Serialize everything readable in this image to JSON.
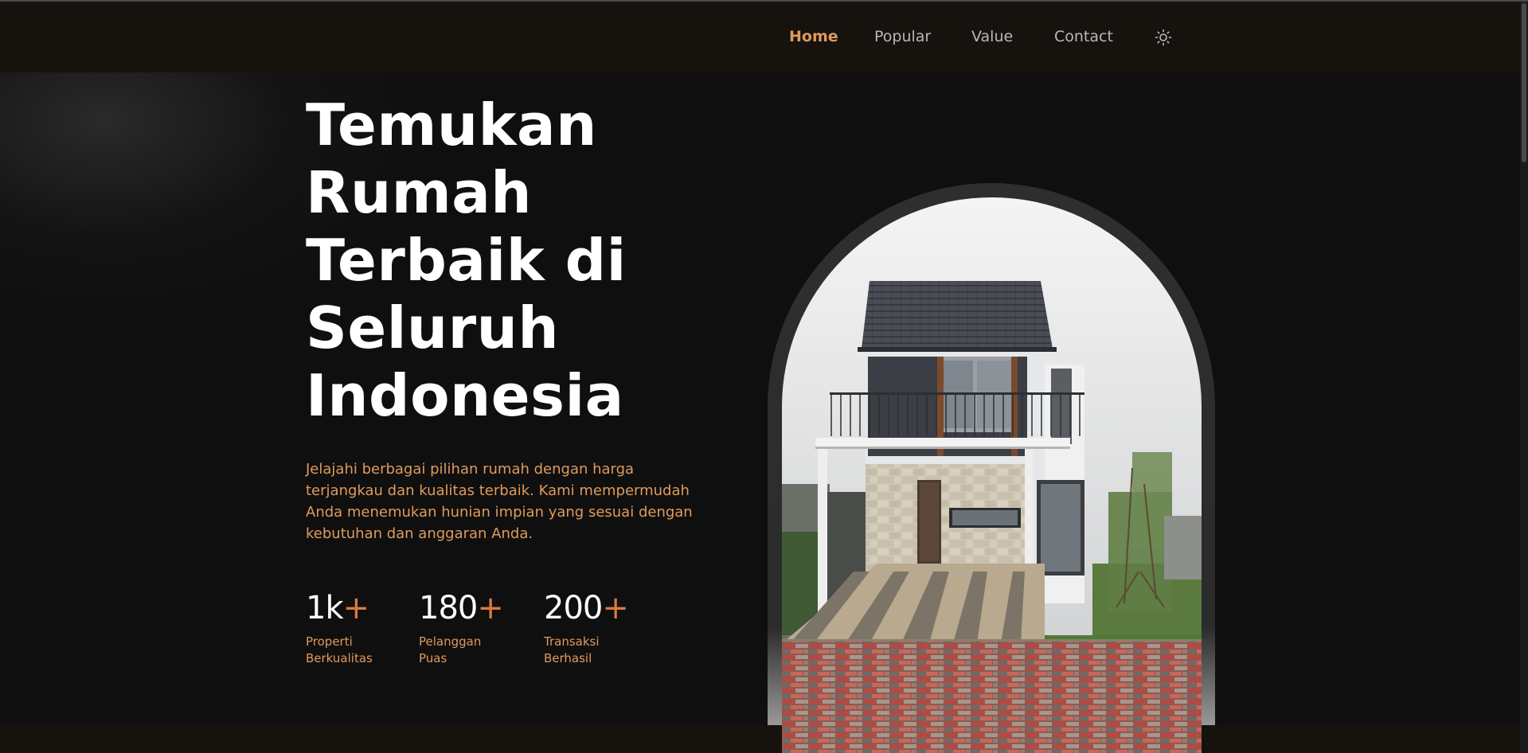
{
  "nav": {
    "items": [
      {
        "label": "Home",
        "active": true
      },
      {
        "label": "Popular",
        "active": false
      },
      {
        "label": "Value",
        "active": false
      },
      {
        "label": "Contact",
        "active": false
      }
    ],
    "theme_toggle_icon": "sun-icon"
  },
  "hero": {
    "title_lines": [
      "Temukan",
      "Rumah",
      "Terbaik di",
      "Seluruh",
      "Indonesia"
    ],
    "description": "Jelajahi berbagai pilihan rumah dengan harga terjangkau dan kualitas terbaik. Kami mempermudah Anda menemukan hunian impian yang sesuai dengan kebutuhan dan anggaran Anda.",
    "stats": [
      {
        "number": "1k",
        "plus": "+",
        "label": "Properti Berkualitas"
      },
      {
        "number": "180",
        "plus": "+",
        "label": "Pelanggan Puas"
      },
      {
        "number": "200",
        "plus": "+",
        "label": "Transaksi Berhasil"
      }
    ],
    "image_subject": "two-story-modern-house"
  },
  "colors": {
    "accent": "#e09a5c",
    "plus": "#d97a3c",
    "background": "#0f0f0f",
    "header": "#16130f"
  }
}
